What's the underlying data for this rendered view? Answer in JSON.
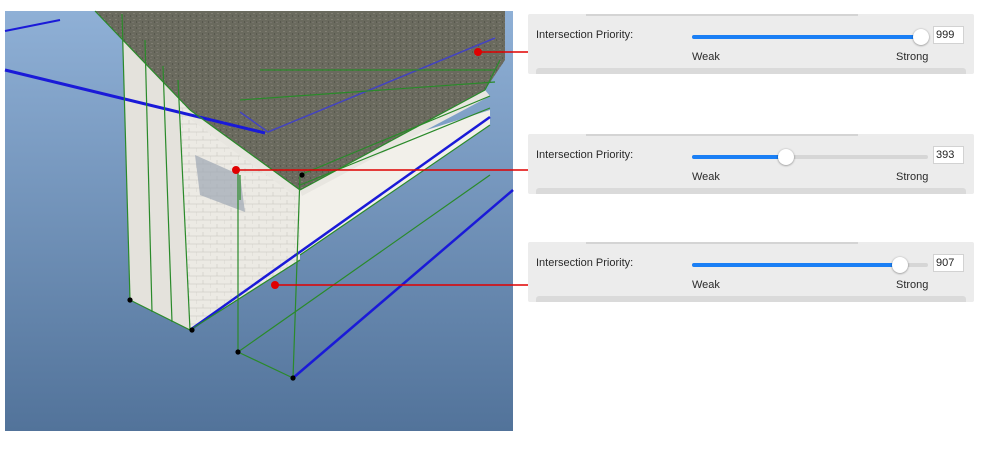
{
  "panels": [
    {
      "label": "Intersection Priority:",
      "value": "999",
      "slider_fraction": 0.97,
      "weak_label": "Weak",
      "strong_label": "Strong"
    },
    {
      "label": "Intersection Priority:",
      "value": "393",
      "slider_fraction": 0.4,
      "weak_label": "Weak",
      "strong_label": "Strong"
    },
    {
      "label": "Intersection Priority:",
      "value": "907",
      "slider_fraction": 0.88,
      "weak_label": "Weak",
      "strong_label": "Strong"
    }
  ],
  "colors": {
    "accent": "#1a7ff5",
    "callout": "#e00000",
    "edge_green": "#2a8a2a",
    "edge_blue": "#1a1ad8",
    "sky_top": "#8fb0d6",
    "sky_bottom": "#52739a"
  }
}
